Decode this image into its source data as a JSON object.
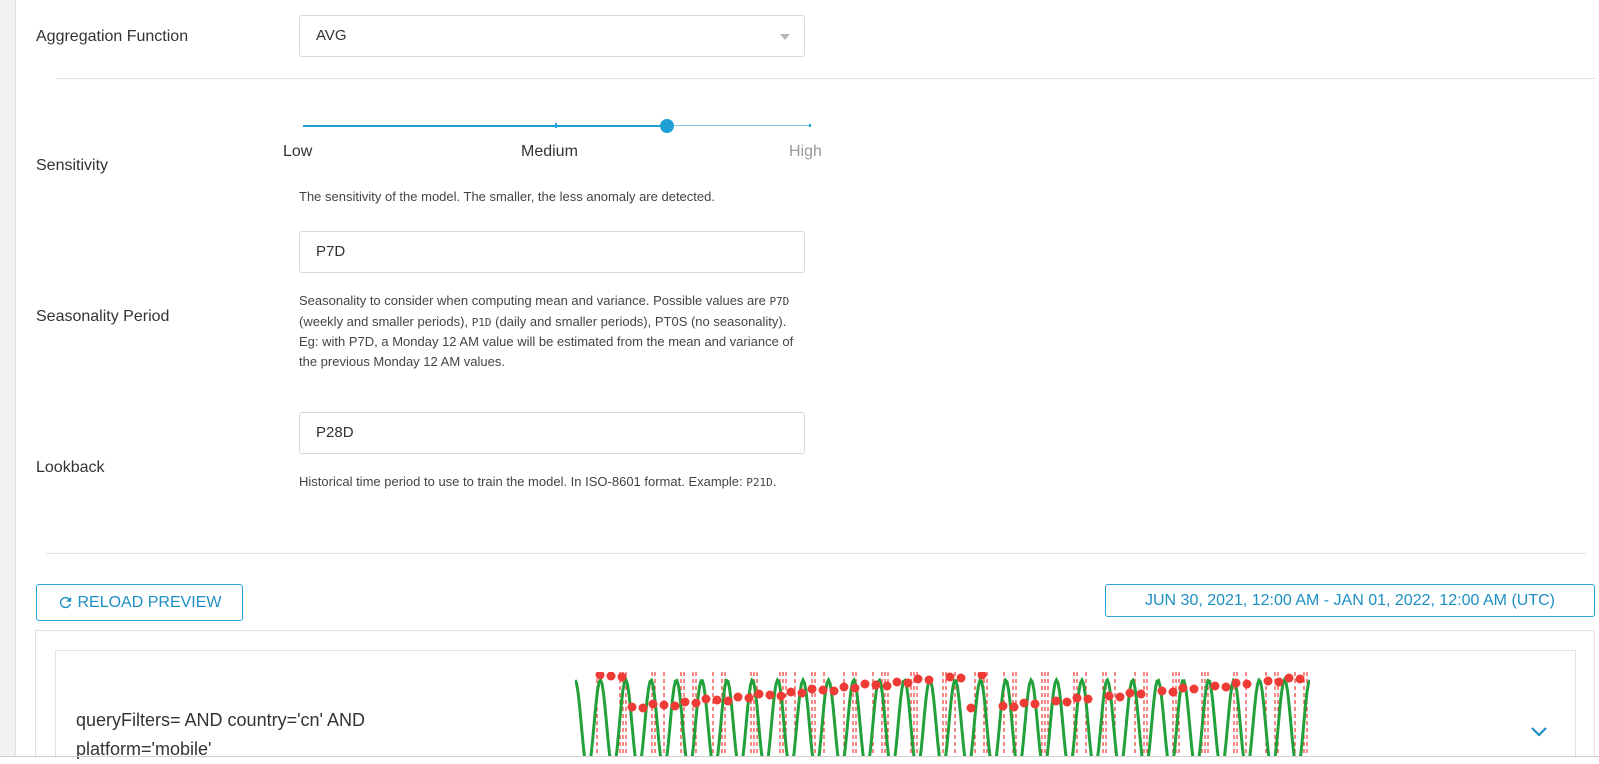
{
  "form": {
    "aggregation": {
      "label": "Aggregation Function",
      "value": "AVG"
    },
    "sensitivity": {
      "label": "Sensitivity",
      "ticks": [
        "Low",
        "Medium",
        "High"
      ],
      "level_fraction": 0.72,
      "help": "The sensitivity of the model. The smaller, the less anomaly are detected."
    },
    "seasonality": {
      "label": "Seasonality Period",
      "value": "P7D",
      "help_parts": [
        "Seasonality to consider when computing mean and variance. Possible values are ",
        "P7D",
        " (weekly and smaller periods), ",
        "P1D",
        " (daily and smaller periods), PT0S (no seasonality). Eg: with P7D, a Monday 12 AM value will be estimated from the mean and variance of the previous Monday 12 AM values."
      ]
    },
    "lookback": {
      "label": "Lookback",
      "value": "P28D",
      "help_parts": [
        "Historical time period to use to train the model. In ISO-8601 format. Example: ",
        "P21D",
        "."
      ]
    }
  },
  "toolbar": {
    "reload_label": "RELOAD PREVIEW",
    "reload_icon": "refresh-icon",
    "date_range_label": "JUN 30, 2021, 12:00 AM - JAN 01, 2022, 12:00 AM (UTC)"
  },
  "preview": {
    "query_filters": "queryFilters= AND country='cn' AND platform='mobile'",
    "expand_icon": "chevron-down-icon",
    "colors": {
      "series": "#22a03a",
      "anomaly": "#ef3b36",
      "accent": "#1e9fd6"
    }
  }
}
